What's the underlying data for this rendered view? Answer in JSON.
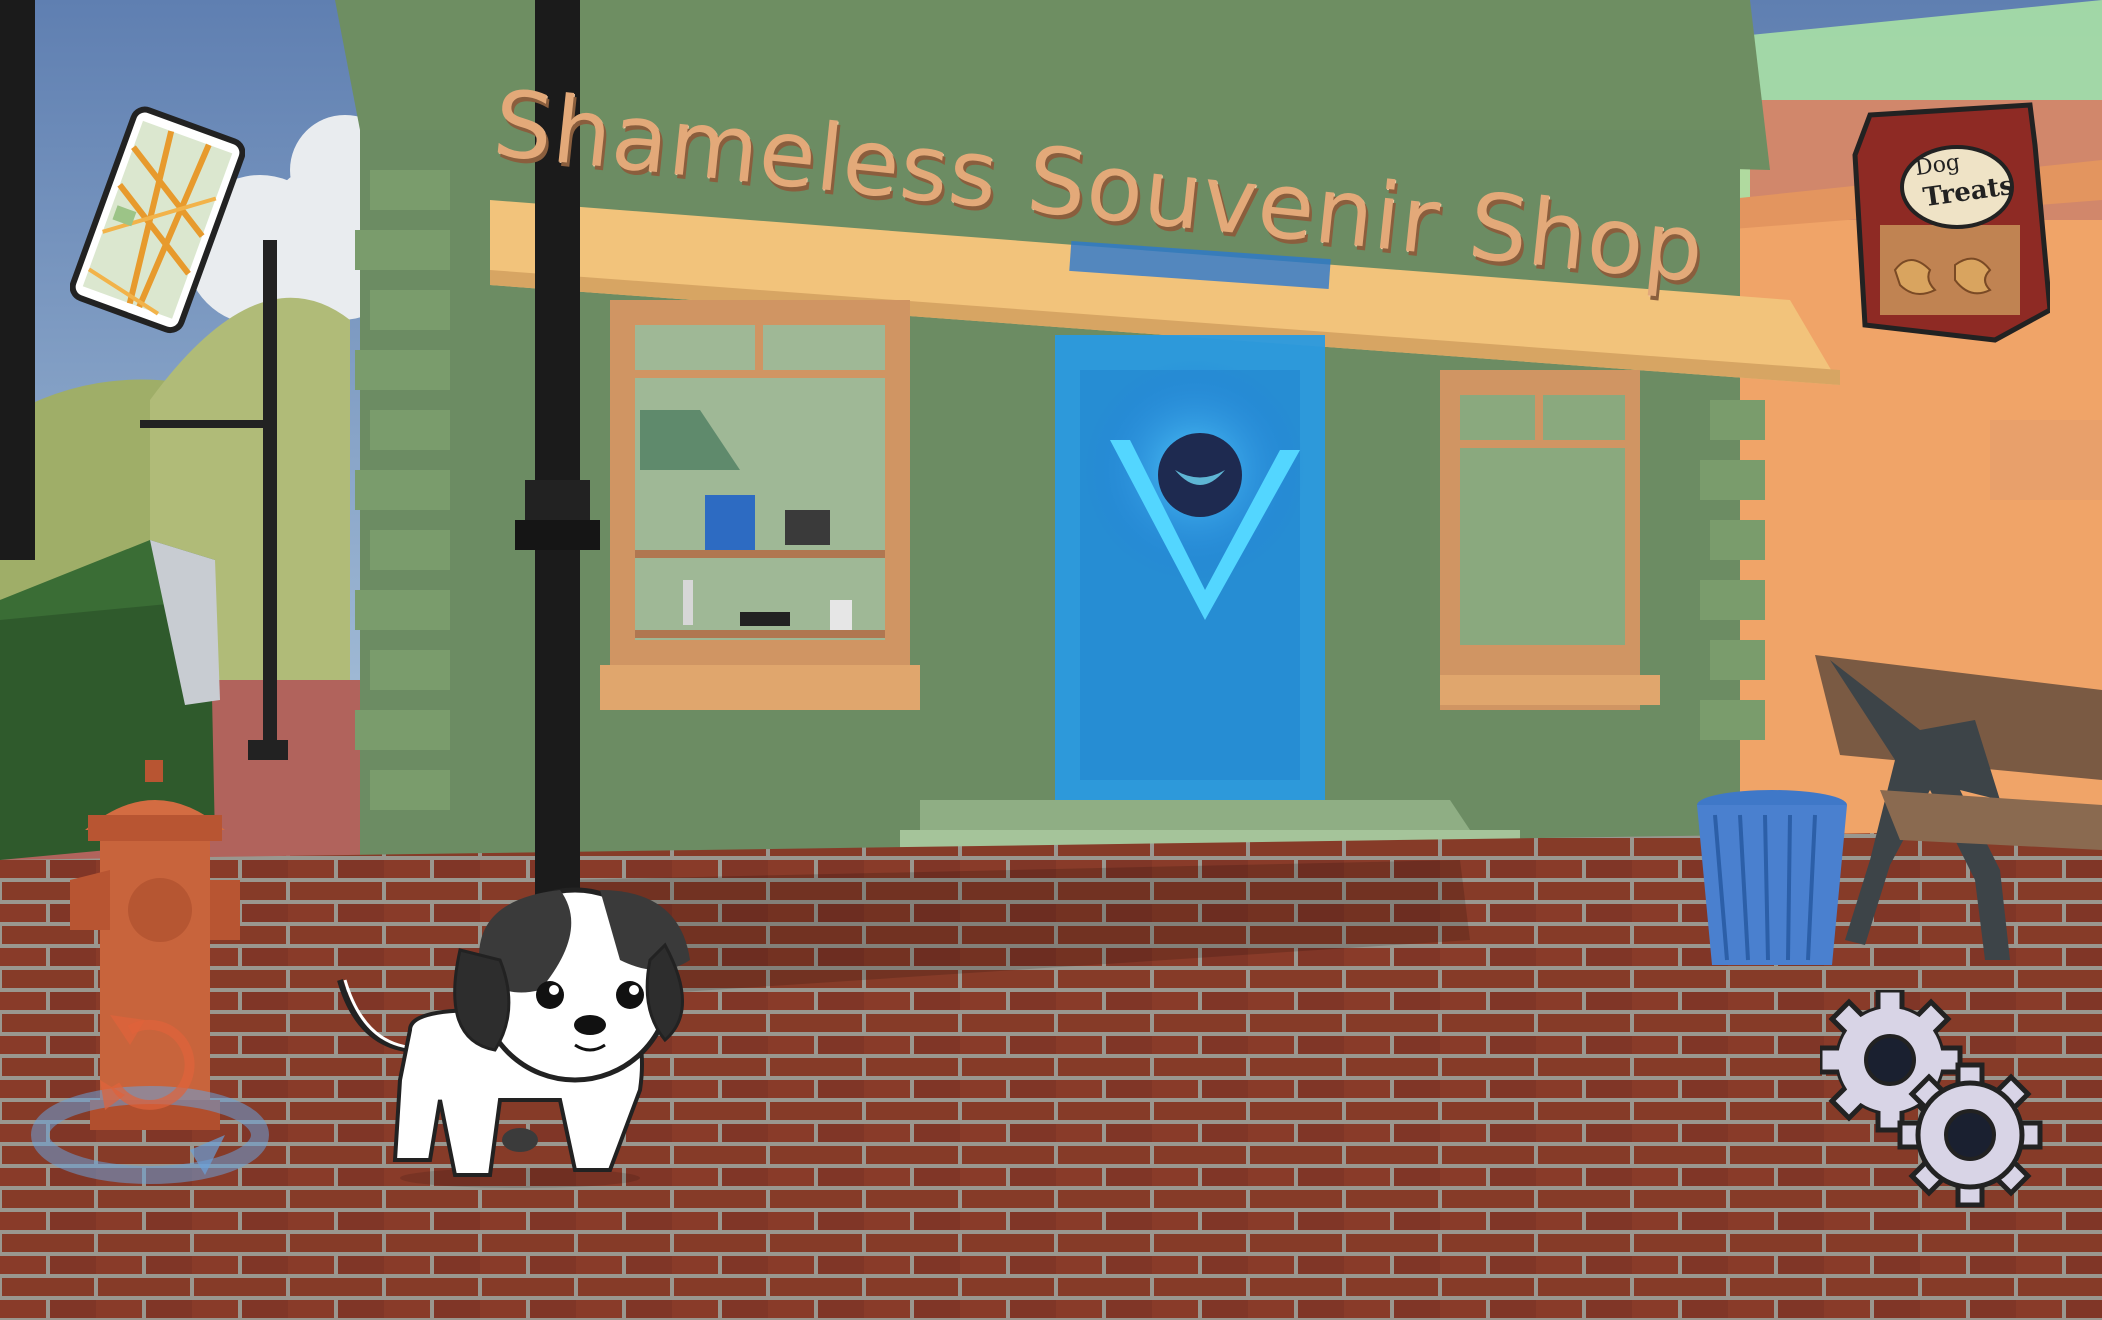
{
  "scene": {
    "shop_sign": "Shameless Souvenir Shop",
    "treat_bag_label": {
      "line1": "Dog",
      "line2": "Treats"
    }
  },
  "hud": {
    "map_button": {
      "icon": "map-icon"
    },
    "treats_button": {
      "icon": "dog-treats-bag-icon"
    },
    "rotate_camera_button": {
      "icon": "rotate-camera-icon"
    },
    "settings_button": {
      "icon": "gear-icon"
    }
  },
  "colors": {
    "sky": "#7fa2c8",
    "shop_wall": "#6c8c63",
    "awning": "#f2c37b",
    "sign_letters": "#e3a979",
    "door_glow": "#2a9ae0",
    "brick": "#8e3f2b",
    "hydrant": "#c8643c",
    "bin": "#4a7fc8"
  }
}
